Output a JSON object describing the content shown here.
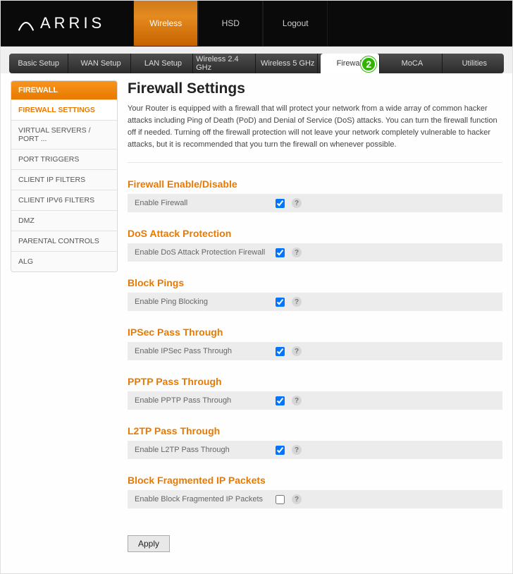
{
  "brand": "ARRIS",
  "topnav": [
    {
      "label": "Wireless",
      "active": true
    },
    {
      "label": "HSD",
      "active": false
    },
    {
      "label": "Logout",
      "active": false
    }
  ],
  "subtabs": [
    {
      "label": "Basic Setup",
      "active": false
    },
    {
      "label": "WAN Setup",
      "active": false
    },
    {
      "label": "LAN Setup",
      "active": false
    },
    {
      "label": "Wireless 2.4 GHz",
      "active": false
    },
    {
      "label": "Wireless 5 GHz",
      "active": false
    },
    {
      "label": "Firewall",
      "active": true,
      "step": "2"
    },
    {
      "label": "MoCA",
      "active": false
    },
    {
      "label": "Utilities",
      "active": false
    }
  ],
  "sidebar": {
    "header": "FIREWALL",
    "items": [
      {
        "label": "FIREWALL SETTINGS",
        "active": true
      },
      {
        "label": "VIRTUAL SERVERS / PORT ...",
        "active": false
      },
      {
        "label": "PORT TRIGGERS",
        "active": false
      },
      {
        "label": "CLIENT IP FILTERS",
        "active": false
      },
      {
        "label": "CLIENT IPV6 FILTERS",
        "active": false
      },
      {
        "label": "DMZ",
        "active": false
      },
      {
        "label": "PARENTAL CONTROLS",
        "active": false
      },
      {
        "label": "ALG",
        "active": false
      }
    ]
  },
  "page": {
    "title": "Firewall Settings",
    "intro": "Your Router is equipped with a firewall that will protect your network from a wide array of common hacker attacks including Ping of Death (PoD) and Denial of Service (DoS) attacks. You can turn the firewall function off if needed. Turning off the firewall protection will not leave your network completely vulnerable to hacker attacks, but it is recommended that you turn the firewall on whenever possible."
  },
  "sections": [
    {
      "heading": "Firewall Enable/Disable",
      "label": "Enable Firewall",
      "checked": true
    },
    {
      "heading": "DoS Attack Protection",
      "label": "Enable DoS Attack Protection Firewall",
      "checked": true
    },
    {
      "heading": "Block Pings",
      "label": "Enable Ping Blocking",
      "checked": true
    },
    {
      "heading": "IPSec Pass Through",
      "label": "Enable IPSec Pass Through",
      "checked": true
    },
    {
      "heading": "PPTP Pass Through",
      "label": "Enable PPTP Pass Through",
      "checked": true
    },
    {
      "heading": "L2TP Pass Through",
      "label": "Enable L2TP Pass Through",
      "checked": true
    },
    {
      "heading": "Block Fragmented IP Packets",
      "label": "Enable Block Fragmented IP Packets",
      "checked": false
    }
  ],
  "apply_label": "Apply",
  "help_tooltip": "?"
}
